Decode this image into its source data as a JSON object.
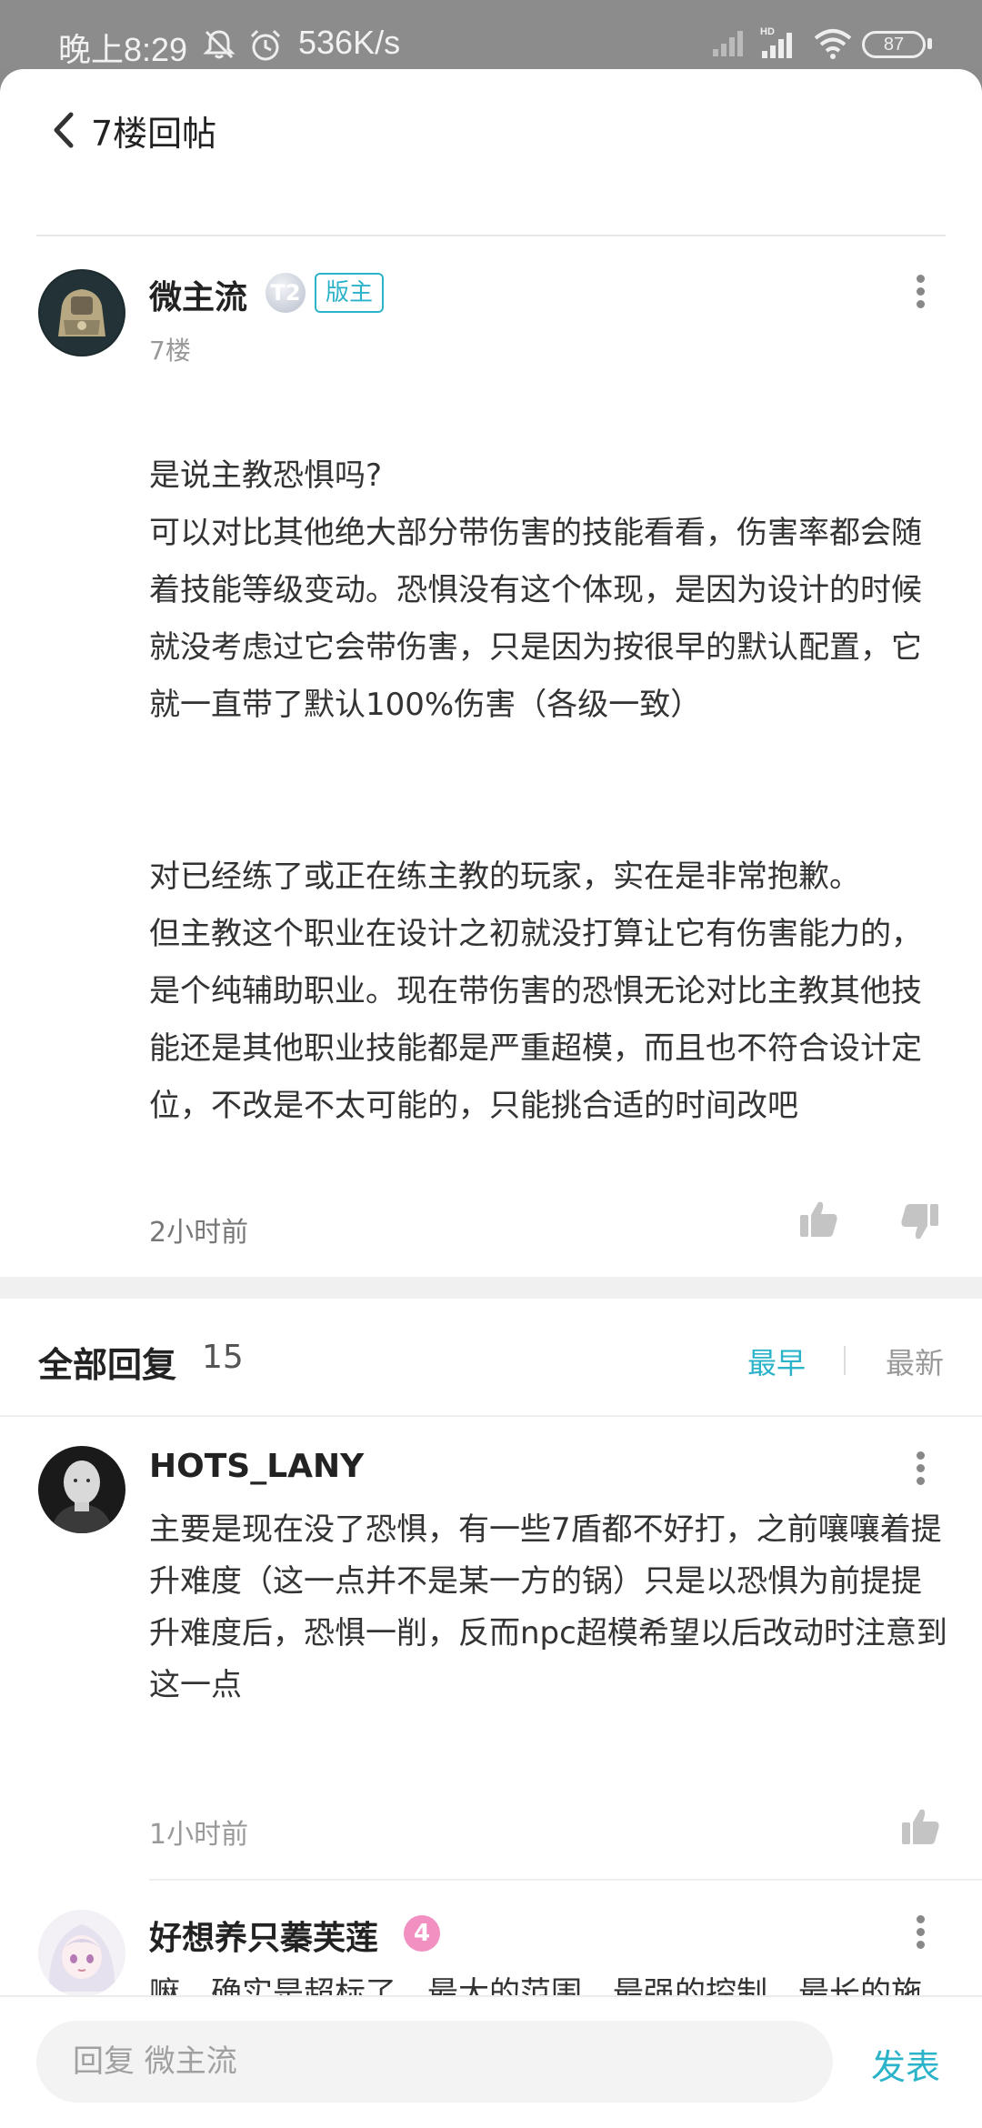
{
  "status_bar": {
    "time": "晚上8:29",
    "network_speed": "536K/s",
    "battery": "87"
  },
  "header": {
    "title": "7楼回帖"
  },
  "post": {
    "username": "微主流",
    "level_badge": "T2",
    "role_badge": "版主",
    "floor": "7楼",
    "paragraphs": [
      "是说主教恐惧吗?",
      "可以对比其他绝大部分带伤害的技能看看，伤害率都会随着技能等级变动。恐惧没有这个体现，是因为设计的时候就没考虑过它会带伤害，只是因为按很早的默认配置，它就一直带了默认100%伤害（各级一致）",
      "对已经练了或正在练主教的玩家，实在是非常抱歉。",
      "但主教这个职业在设计之初就没打算让它有伤害能力的，是个纯辅助职业。现在带伤害的恐惧无论对比主教其他技能还是其他职业技能都是严重超模，而且也不符合设计定位，不改是不太可能的，只能挑合适的时间改吧"
    ],
    "time": "2小时前"
  },
  "replies_section": {
    "title": "全部回复",
    "count": "15",
    "sort_earliest": "最早",
    "sort_latest": "最新"
  },
  "replies": [
    {
      "username": "HOTS_LANY",
      "text": "主要是现在没了恐惧，有一些7盾都不好打，之前嚷嚷着提升难度（这一点并不是某一方的锅）只是以恐惧为前提提升难度后，恐惧一削，反而npc超模希望以后改动时注意到这一点",
      "time": "1小时前"
    },
    {
      "username": "好想养只蓁芙莲",
      "vip_level": "4",
      "text": "嘛。确实是超标了。最大的范围，最强的控制，最长的施法距离。不过和现在对比确实让人不太适应。"
    }
  ],
  "bottom_bar": {
    "placeholder": "回复 微主流",
    "send_label": "发表"
  },
  "colors": {
    "accent": "#2bb3c9",
    "vip_badge": "#f390c2"
  }
}
